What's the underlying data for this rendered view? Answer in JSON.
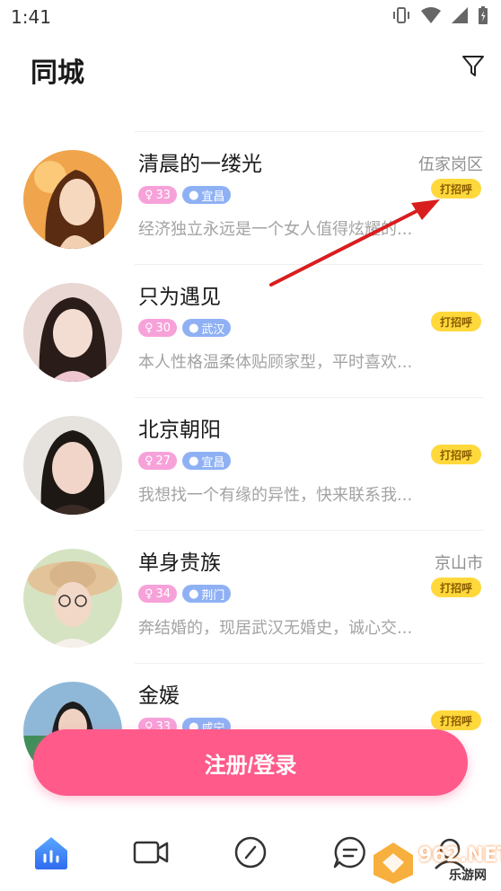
{
  "status_bar": {
    "time": "1:41"
  },
  "header": {
    "title": "同城"
  },
  "profiles": [
    {
      "name": "清晨的一缕光",
      "location": "伍家岗区",
      "age": "33",
      "city": "宜昌",
      "greet_label": "打招呼",
      "bio": "经济独立永远是一个女人值得炫耀的...",
      "avatar_colors": [
        "#f2b366",
        "#6b3b1a",
        "#f6d8bf"
      ]
    },
    {
      "name": "只为遇见",
      "location": "",
      "age": "30",
      "city": "武汉",
      "greet_label": "打招呼",
      "bio": "本人性格温柔体贴顾家型，平时喜欢...",
      "avatar_colors": [
        "#e8d7d3",
        "#2a1c18",
        "#f3ddd2"
      ]
    },
    {
      "name": "北京朝阳",
      "location": "",
      "age": "27",
      "city": "宜昌",
      "greet_label": "打招呼",
      "bio": "我想找一个有缘的异性，快来联系我...",
      "avatar_colors": [
        "#e6e2de",
        "#1e1815",
        "#f0d5c8"
      ]
    },
    {
      "name": "单身贵族",
      "location": "京山市",
      "age": "34",
      "city": "荆门",
      "greet_label": "打招呼",
      "bio": "奔结婚的，现居武汉无婚史，诚心交...",
      "avatar_colors": [
        "#d6e3c2",
        "#d8b48a",
        "#f2d8c6"
      ]
    },
    {
      "name": "金媛",
      "location": "",
      "age": "33",
      "city": "咸宁",
      "greet_label": "打招呼",
      "bio": "",
      "avatar_colors": [
        "#3f8f5a",
        "#1c1c1c",
        "#efd2c2"
      ]
    }
  ],
  "register_button": {
    "label": "注册/登录"
  },
  "bottom_nav": [
    {
      "icon": "home-radar-icon",
      "active": true
    },
    {
      "icon": "video-camera-icon",
      "active": false
    },
    {
      "icon": "compass-icon",
      "active": false
    },
    {
      "icon": "chat-bubble-icon",
      "active": false
    },
    {
      "icon": "profile-icon",
      "active": false
    }
  ],
  "watermark": {
    "text": "962.NET",
    "sub": "乐游网"
  },
  "colors": {
    "accent_pink": "#ff5a8a",
    "greet_yellow": "#ffd83b",
    "tag_age": "#f7a1d9",
    "tag_city": "#8fb1f4",
    "annotation_red": "#d81e1e"
  }
}
